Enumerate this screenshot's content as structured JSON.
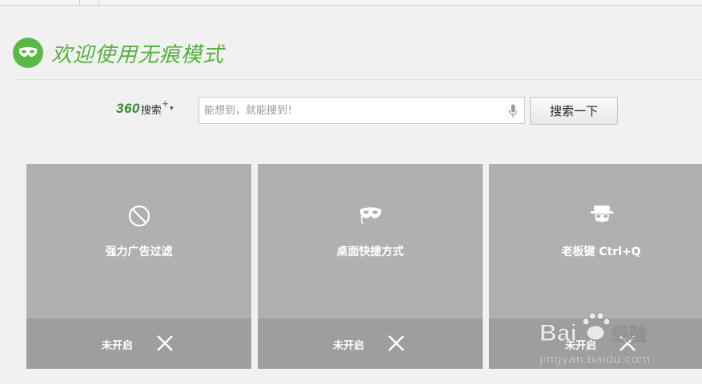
{
  "header": {
    "title": "欢迎使用无痕模式",
    "logo_icon": "mask-icon",
    "accent_color": "#5aba47"
  },
  "search": {
    "brand_number": "360",
    "brand_word": "搜索",
    "brand_plus": "+",
    "brand_caret": "▾",
    "placeholder": "能想到，就能搜到！",
    "value": "",
    "button_label": "搜索一下"
  },
  "cards": [
    {
      "icon": "no-entry-icon",
      "label": "强力广告过滤",
      "status": "未开启"
    },
    {
      "icon": "mask-icon",
      "label": "桌面快捷方式",
      "status": "未开启"
    },
    {
      "icon": "boss-face-icon",
      "label": "老板键 Ctrl+Q",
      "status": "未开启"
    }
  ],
  "watermark": {
    "brand": "Bai",
    "brand_suffix": "经验",
    "url": "jingyan.baidu.com"
  }
}
